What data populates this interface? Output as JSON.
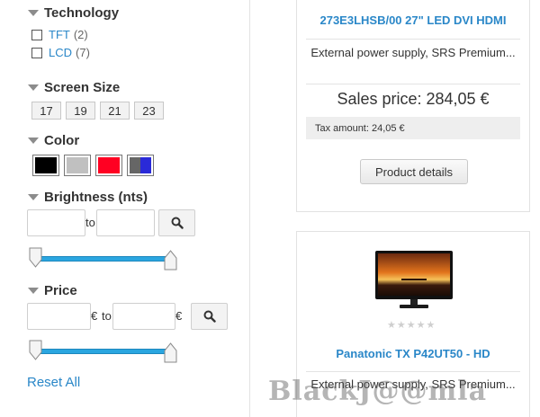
{
  "filters": {
    "technology": {
      "title": "Technology",
      "options": [
        {
          "label": "TFT",
          "count": "(2)"
        },
        {
          "label": "LCD",
          "count": "(7)"
        }
      ]
    },
    "screen_size": {
      "title": "Screen Size",
      "sizes": [
        "17",
        "19",
        "21",
        "23"
      ]
    },
    "color": {
      "title": "Color",
      "swatches": [
        {
          "name": "black",
          "color": "#000000"
        },
        {
          "name": "silver",
          "color": "#c0c0c0"
        },
        {
          "name": "red",
          "color": "#ff0022"
        },
        {
          "name": "grey-blue",
          "color_left": "#666666",
          "color_right": "#2a2ad8"
        }
      ]
    },
    "brightness": {
      "title": "Brightness (nts)",
      "from_value": "",
      "to_label": "to",
      "to_value": ""
    },
    "price": {
      "title": "Price",
      "from_value": "",
      "currency": "€",
      "to_label": "to",
      "to_value": ""
    },
    "reset_label": "Reset All"
  },
  "products": [
    {
      "title": "273E3LHSB/00 27\" LED DVI HDMI",
      "description": "External power supply, SRS Premium...",
      "price": "Sales price: 284,05 €",
      "tax": "Tax amount: 24,05 €",
      "details_label": "Product details"
    },
    {
      "title": "Panatonic TX P42UT50 - HD",
      "description": "External power supply, SRS Premium...",
      "rating_stars": 0,
      "rating_max": 5
    }
  ],
  "watermark": "BlackJ@@mla",
  "colors": {
    "link": "#2a87c8",
    "slider": "#2aa6e0"
  }
}
